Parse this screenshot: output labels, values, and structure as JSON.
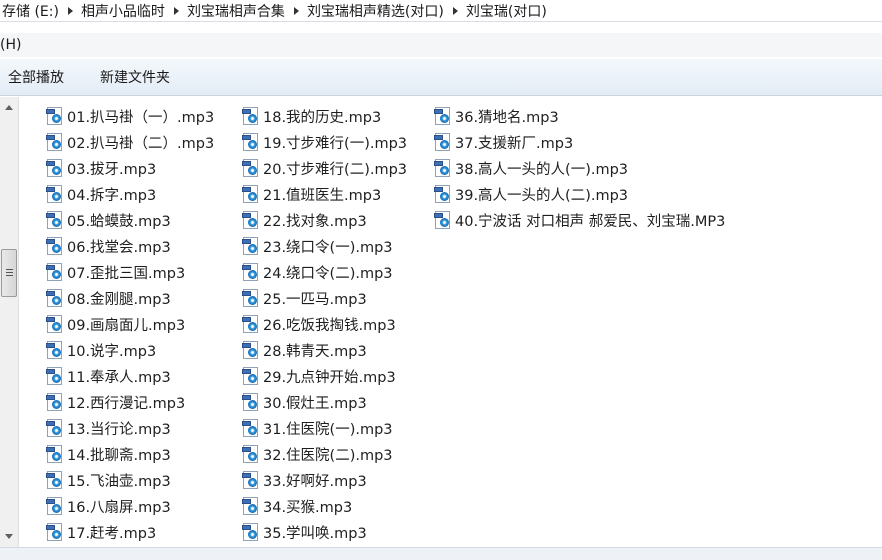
{
  "breadcrumb": [
    "存储 (E:)",
    "相声小品临时",
    "刘宝瑞相声合集",
    "刘宝瑞相声精选(对口)",
    "刘宝瑞(对口)"
  ],
  "menu": {
    "help": "(H)"
  },
  "toolbar": {
    "play_all": "全部播放",
    "new_folder": "新建文件夹"
  },
  "files": {
    "col1": [
      "01.扒马褂（一）.mp3",
      "02.扒马褂（二）.mp3",
      "03.拔牙.mp3",
      "04.拆字.mp3",
      "05.蛤蟆鼓.mp3",
      "06.找堂会.mp3",
      "07.歪批三国.mp3",
      "08.金刚腿.mp3",
      "09.画扇面儿.mp3",
      "10.说字.mp3",
      "11.奉承人.mp3",
      "12.西行漫记.mp3",
      "13.当行论.mp3",
      "14.批聊斋.mp3",
      "15.飞油壶.mp3",
      "16.八扇屏.mp3",
      "17.赶考.mp3"
    ],
    "col2": [
      "18.我的历史.mp3",
      "19.寸步难行(一).mp3",
      "20.寸步难行(二).mp3",
      "21.值班医生.mp3",
      "22.找对象.mp3",
      "23.绕口令(一).mp3",
      "24.绕口令(二).mp3",
      "25.一匹马.mp3",
      "26.吃饭我掏钱.mp3",
      "28.韩青天.mp3",
      "29.九点钟开始.mp3",
      "30.假灶王.mp3",
      "31.住医院(一).mp3",
      "32.住医院(二).mp3",
      "33.好啊好.mp3",
      "34.买猴.mp3",
      "35.学叫唤.mp3"
    ],
    "col3": [
      "36.猜地名.mp3",
      "37.支援新厂.mp3",
      "38.高人一头的人(一).mp3",
      "39.高人一头的人(二).mp3",
      "40.宁波话 对口相声 郝爱民、刘宝瑞.MP3"
    ]
  }
}
